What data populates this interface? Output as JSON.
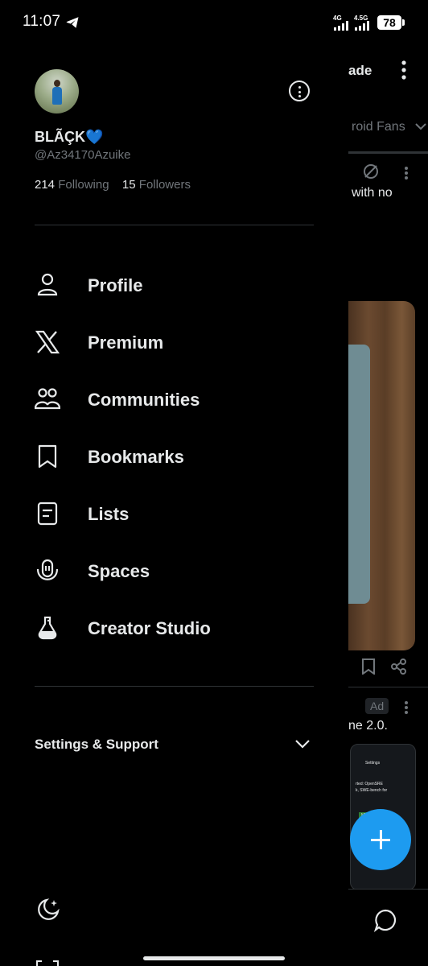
{
  "status_bar": {
    "time": "11:07",
    "signal1_label": "4G",
    "signal2_label": "4.5G",
    "battery": "78"
  },
  "background_timeline": {
    "header_text": "ade",
    "tab_text": "roid Fans",
    "post_text": "with no",
    "ad_badge": "Ad",
    "ad_text": "ne 2.0.",
    "ad_card_lines": [
      "Settings",
      "rted: OpenSRE",
      "k, SWE-bench for",
      "Mis"
    ]
  },
  "profile": {
    "display_name": "BLÃÇK💙",
    "handle": "@Az34170Azuike",
    "following_count": "214",
    "following_label": "Following",
    "followers_count": "15",
    "followers_label": "Followers"
  },
  "menu": {
    "items": [
      {
        "label": "Profile",
        "icon": "person-icon"
      },
      {
        "label": "Premium",
        "icon": "x-logo-icon"
      },
      {
        "label": "Communities",
        "icon": "communities-icon"
      },
      {
        "label": "Bookmarks",
        "icon": "bookmark-icon"
      },
      {
        "label": "Lists",
        "icon": "list-icon"
      },
      {
        "label": "Spaces",
        "icon": "spaces-icon"
      },
      {
        "label": "Creator Studio",
        "icon": "flask-icon"
      }
    ]
  },
  "settings": {
    "label": "Settings & Support"
  },
  "colors": {
    "background": "#000000",
    "text": "#e7e9ea",
    "muted": "#71767b",
    "divider": "#2f3336",
    "accent": "#1d9bf0"
  }
}
